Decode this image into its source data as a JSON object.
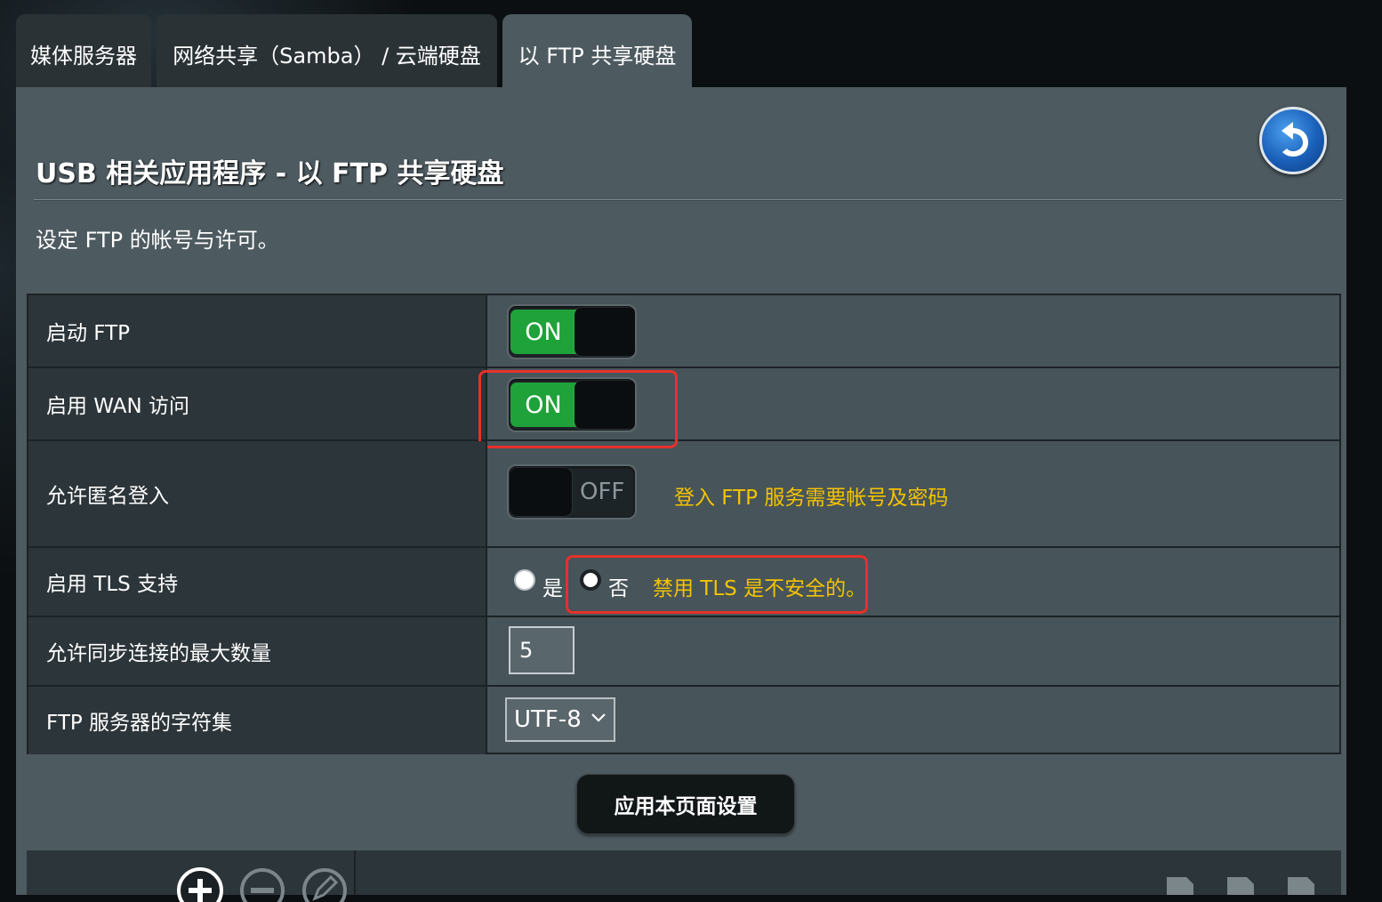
{
  "tabs": [
    {
      "label": "媒体服务器"
    },
    {
      "label": "网络共享（Samba） / 云端硬盘"
    },
    {
      "label": "以 FTP 共享硬盘"
    }
  ],
  "page": {
    "title": "USB 相关应用程序 - 以 FTP 共享硬盘",
    "description": "设定 FTP 的帐号与许可。"
  },
  "settings": {
    "enable_ftp": {
      "label": "启动 FTP",
      "state": "ON"
    },
    "enable_wan": {
      "label": "启用 WAN 访问",
      "state": "ON"
    },
    "anonymous": {
      "label": "允许匿名登入",
      "state": "OFF",
      "hint": "登入 FTP 服务需要帐号及密码"
    },
    "tls": {
      "label": "启用 TLS 支持",
      "yes": "是",
      "no": "否",
      "hint": "禁用 TLS 是不安全的。"
    },
    "max_connections": {
      "label": "允许同步连接的最大数量",
      "value": "5"
    },
    "charset": {
      "label": "FTP 服务器的字符集",
      "value": "UTF-8"
    }
  },
  "actions": {
    "apply": "应用本页面设置"
  },
  "colors": {
    "accent_on": "#1fa23a",
    "hint": "#f4c300",
    "highlight": "#e5312a"
  }
}
